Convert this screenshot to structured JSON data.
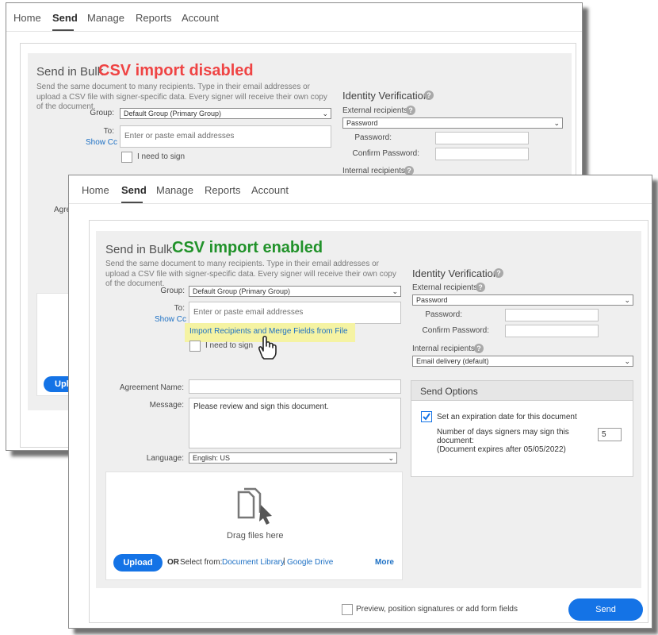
{
  "back_window": {
    "nav": [
      "Home",
      "Send",
      "Manage",
      "Reports",
      "Account"
    ],
    "active_tab": "Send",
    "title": "Send in Bulk",
    "badge": "CSV import disabled",
    "description": "Send the same document to many recipients. Type in their email addresses or upload a CSV file with signer-specific data. Every signer will receive their own copy of the document.",
    "group_label": "Group:",
    "group_value": "Default Group (Primary Group)",
    "to_label": "To:",
    "to_placeholder": "Enter or paste email addresses",
    "show_cc": "Show Cc",
    "need_to_sign": "I need to sign",
    "identity_title": "Identity Verification",
    "external_label": "External recipients",
    "external_value": "Password",
    "password_label": "Password:",
    "confirm_label": "Confirm Password:",
    "internal_label": "Internal recipients",
    "partial_label": "Agre",
    "partial_upload": "Upl"
  },
  "front_window": {
    "nav": [
      "Home",
      "Send",
      "Manage",
      "Reports",
      "Account"
    ],
    "active_tab": "Send",
    "title": "Send in Bulk",
    "badge": "CSV import enabled",
    "description": "Send the same document to many recipients. Type in their email addresses or upload a CSV file with signer-specific data. Every signer will receive their own copy of the document.",
    "group_label": "Group:",
    "group_value": "Default Group (Primary Group)",
    "to_label": "To:",
    "to_placeholder": "Enter or paste email addresses",
    "show_cc": "Show Cc",
    "import_link": "Import Recipients and Merge Fields from File",
    "need_to_sign": "I need to sign",
    "agreement_name_label": "Agreement Name:",
    "agreement_name_value": "",
    "message_label": "Message:",
    "message_value": "Please review and sign this document.",
    "language_label": "Language:",
    "language_value": "English: US",
    "drag_text": "Drag files here",
    "upload_button": "Upload",
    "or_select": "OR",
    "select_from": "Select from:",
    "document_library": "Document Library",
    "separator": "|",
    "google_drive": "Google Drive",
    "more": "More",
    "identity_title": "Identity Verification",
    "external_label": "External recipients",
    "external_value": "Password",
    "password_label": "Password:",
    "confirm_label": "Confirm Password:",
    "internal_label": "Internal recipients",
    "internal_value": "Email delivery (default)",
    "send_options_title": "Send Options",
    "expiration_label": "Set an expiration date for this document",
    "expiration_checked": true,
    "days_label_1": "Number of days signers may sign this",
    "days_label_2": "document:",
    "days_label_3": "(Document expires after 05/05/2022)",
    "days_value": "5",
    "preview_label": "Preview, position signatures or add form fields",
    "send_button": "Send"
  },
  "colors": {
    "disabled_badge": "#ef4444",
    "enabled_badge": "#21922a",
    "link_blue": "#1d70c4",
    "button_blue": "#1473e6",
    "import_highlight": "#f5f3a3"
  },
  "icons": [
    "help-icon",
    "document-stack-icon",
    "hand-pointer-cursor-icon",
    "chevron-down-icon",
    "checkmark-icon"
  ]
}
